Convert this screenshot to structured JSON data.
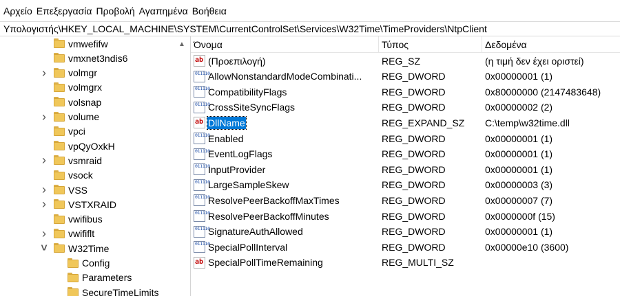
{
  "menu": [
    "Αρχείο",
    "Επεξεργασία",
    "Προβολή",
    "Αγαπημένα",
    "Βοήθεια"
  ],
  "address": "Υπολογιστής\\HKEY_LOCAL_MACHINE\\SYSTEM\\CurrentControlSet\\Services\\W32Time\\TimeProviders\\NtpClient",
  "tree": [
    {
      "label": "vmwefifw",
      "expander": false,
      "depth": 0
    },
    {
      "label": "vmxnet3ndis6",
      "expander": false,
      "depth": 0
    },
    {
      "label": "volmgr",
      "expander": "collapsed",
      "depth": 0
    },
    {
      "label": "volmgrx",
      "expander": false,
      "depth": 0
    },
    {
      "label": "volsnap",
      "expander": false,
      "depth": 0
    },
    {
      "label": "volume",
      "expander": "collapsed",
      "depth": 0
    },
    {
      "label": "vpci",
      "expander": false,
      "depth": 0
    },
    {
      "label": "vpQyOxkH",
      "expander": false,
      "depth": 0
    },
    {
      "label": "vsmraid",
      "expander": "collapsed",
      "depth": 0
    },
    {
      "label": "vsock",
      "expander": false,
      "depth": 0
    },
    {
      "label": "VSS",
      "expander": "collapsed",
      "depth": 0
    },
    {
      "label": "VSTXRAID",
      "expander": "collapsed",
      "depth": 0
    },
    {
      "label": "vwifibus",
      "expander": false,
      "depth": 0
    },
    {
      "label": "vwififlt",
      "expander": "collapsed",
      "depth": 0
    },
    {
      "label": "W32Time",
      "expander": "expanded",
      "depth": 0
    },
    {
      "label": "Config",
      "expander": false,
      "depth": 1
    },
    {
      "label": "Parameters",
      "expander": false,
      "depth": 1
    },
    {
      "label": "SecureTimeLimits",
      "expander": false,
      "depth": 1
    }
  ],
  "columns": {
    "name": "Όνομα",
    "type": "Τύπος",
    "data": "Δεδομένα"
  },
  "values": [
    {
      "name": "(Προεπιλογή)",
      "type": "REG_SZ",
      "data": "(η τιμή δεν έχει οριστεί)",
      "icon": "string"
    },
    {
      "name": "AllowNonstandardModeCombinati...",
      "type": "REG_DWORD",
      "data": "0x00000001 (1)",
      "icon": "binary"
    },
    {
      "name": "CompatibilityFlags",
      "type": "REG_DWORD",
      "data": "0x80000000 (2147483648)",
      "icon": "binary"
    },
    {
      "name": "CrossSiteSyncFlags",
      "type": "REG_DWORD",
      "data": "0x00000002 (2)",
      "icon": "binary"
    },
    {
      "name": "DllName",
      "type": "REG_EXPAND_SZ",
      "data": "C:\\temp\\w32time.dll",
      "icon": "string",
      "selected": true
    },
    {
      "name": "Enabled",
      "type": "REG_DWORD",
      "data": "0x00000001 (1)",
      "icon": "binary"
    },
    {
      "name": "EventLogFlags",
      "type": "REG_DWORD",
      "data": "0x00000001 (1)",
      "icon": "binary"
    },
    {
      "name": "InputProvider",
      "type": "REG_DWORD",
      "data": "0x00000001 (1)",
      "icon": "binary"
    },
    {
      "name": "LargeSampleSkew",
      "type": "REG_DWORD",
      "data": "0x00000003 (3)",
      "icon": "binary"
    },
    {
      "name": "ResolvePeerBackoffMaxTimes",
      "type": "REG_DWORD",
      "data": "0x00000007 (7)",
      "icon": "binary"
    },
    {
      "name": "ResolvePeerBackoffMinutes",
      "type": "REG_DWORD",
      "data": "0x0000000f (15)",
      "icon": "binary"
    },
    {
      "name": "SignatureAuthAllowed",
      "type": "REG_DWORD",
      "data": "0x00000001 (1)",
      "icon": "binary"
    },
    {
      "name": "SpecialPollInterval",
      "type": "REG_DWORD",
      "data": "0x00000e10 (3600)",
      "icon": "binary"
    },
    {
      "name": "SpecialPollTimeRemaining",
      "type": "REG_MULTI_SZ",
      "data": "",
      "icon": "string"
    }
  ],
  "icon_glyphs": {
    "string": "ab",
    "binary": "011110"
  },
  "colors": {
    "selection": "#0078d7",
    "folder": "#f0c75a"
  }
}
